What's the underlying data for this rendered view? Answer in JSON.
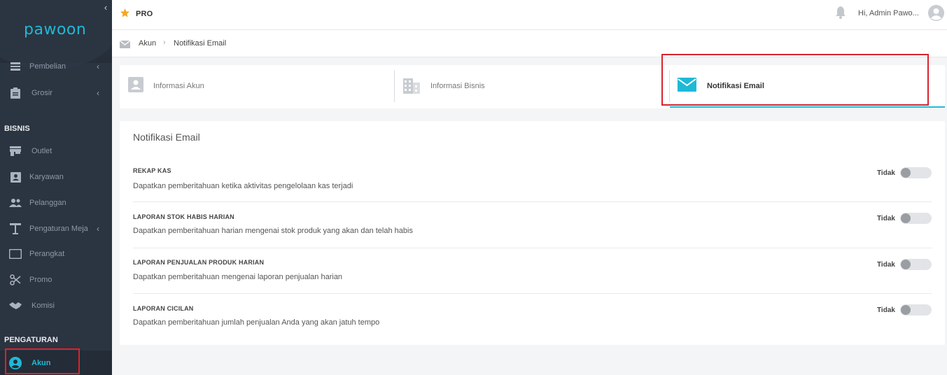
{
  "app": {
    "logo": "pawoon"
  },
  "sidebar": {
    "items_top": [
      {
        "label": "Pembelian",
        "icon": "list-icon"
      },
      {
        "label": "Grosir",
        "icon": "clipboard-icon"
      }
    ],
    "section_bisnis": "BISNIS",
    "items_bisnis": [
      {
        "label": "Outlet",
        "icon": "store-icon"
      },
      {
        "label": "Karyawan",
        "icon": "id-card-icon"
      },
      {
        "label": "Pelanggan",
        "icon": "people-icon"
      },
      {
        "label": "Pengaturan Meja",
        "icon": "table-icon"
      },
      {
        "label": "Perangkat",
        "icon": "tablet-icon"
      },
      {
        "label": "Promo",
        "icon": "scissors-icon"
      },
      {
        "label": "Komisi",
        "icon": "handshake-icon"
      }
    ],
    "section_pengaturan": "PENGATURAN",
    "active_item": {
      "label": "Akun",
      "icon": "user-circle-icon"
    }
  },
  "topbar": {
    "plan": "PRO",
    "greeting": "Hi, Admin Pawo..."
  },
  "breadcrumb": {
    "root": "Akun",
    "current": "Notifikasi Email"
  },
  "tabs": [
    {
      "label": "Informasi Akun",
      "icon": "user-card-icon"
    },
    {
      "label": "Informasi Bisnis",
      "icon": "building-icon"
    },
    {
      "label": "Notifikasi Email",
      "icon": "envelope-icon",
      "active": true
    }
  ],
  "card": {
    "title": "Notifikasi Email",
    "rows": [
      {
        "title": "REKAP KAS",
        "desc": "Dapatkan pemberitahuan ketika aktivitas pengelolaan kas terjadi",
        "value": "Tidak",
        "enabled": false
      },
      {
        "title": "LAPORAN STOK HABIS HARIAN",
        "desc": "Dapatkan pemberitahuan harian mengenai stok produk yang akan dan telah habis",
        "value": "Tidak",
        "enabled": false
      },
      {
        "title": "LAPORAN PENJUALAN PRODUK HARIAN",
        "desc": "Dapatkan pemberitahuan mengenai laporan penjualan harian",
        "value": "Tidak",
        "enabled": false
      },
      {
        "title": "LAPORAN CICILAN",
        "desc": "Dapatkan pemberitahuan jumlah penjualan Anda yang akan jatuh tempo",
        "value": "Tidak",
        "enabled": false
      }
    ]
  },
  "colors": {
    "accent": "#1fb9d6",
    "sidebar": "#2b3441",
    "highlight": "#d9232e",
    "star": "#f5a623"
  }
}
